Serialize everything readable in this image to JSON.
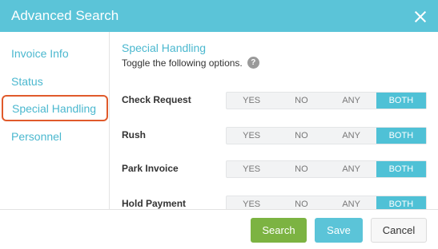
{
  "dialog": {
    "title": "Advanced Search",
    "close_icon": "close-icon"
  },
  "sidebar": {
    "items": [
      {
        "label": "Invoice Info"
      },
      {
        "label": "Status"
      },
      {
        "label": "Special Handling",
        "active": true
      },
      {
        "label": "Personnel"
      }
    ]
  },
  "section": {
    "title": "Special Handling",
    "subtitle": "Toggle the following options.",
    "help_icon": "question-icon",
    "help_glyph": "?"
  },
  "options": [
    {
      "label": "Check Request",
      "selected": "BOTH"
    },
    {
      "label": "Rush",
      "selected": "BOTH"
    },
    {
      "label": "Park Invoice",
      "selected": "BOTH"
    },
    {
      "label": "Hold Payment",
      "selected": "BOTH"
    }
  ],
  "toggle_values": [
    "YES",
    "NO",
    "ANY",
    "BOTH"
  ],
  "footer": {
    "search_label": "Search",
    "save_label": "Save",
    "cancel_label": "Cancel"
  },
  "colors": {
    "accent": "#5bc4d8",
    "search": "#7cb342",
    "active_outline": "#e05a2b"
  }
}
